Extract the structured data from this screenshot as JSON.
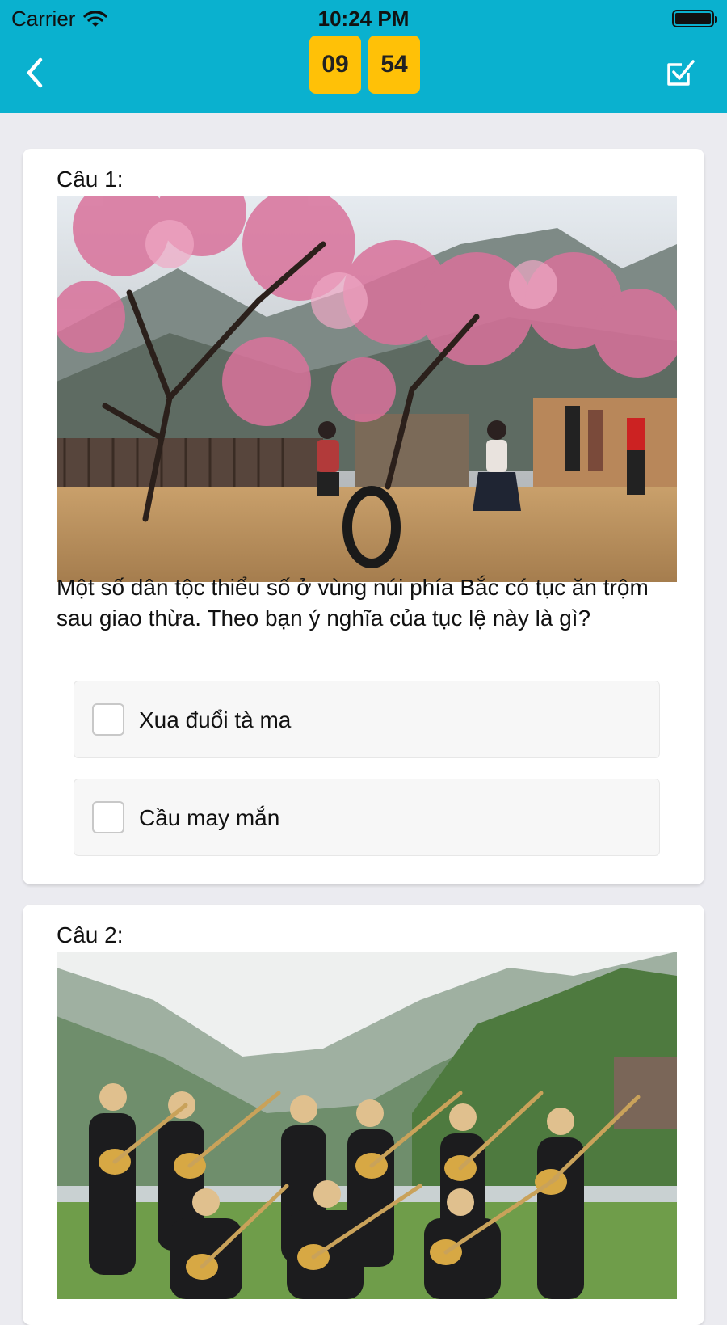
{
  "status_bar": {
    "carrier": "Carrier",
    "time": "10:24 PM",
    "battery_level": 1.0
  },
  "header": {
    "background": "#0AB1CF",
    "back_icon": "chevron-left-icon",
    "timer_minutes": "09",
    "timer_seconds": "54",
    "timer_color": "#FFC107",
    "submit_icon": "checkbox-edit-icon"
  },
  "questions": [
    {
      "label": "Câu 1:",
      "image": "photo-children-playing-under-peach-blossom-tree",
      "text": "Một số dân tộc thiểu số ở vùng núi phía Bắc có tục ăn trộm sau giao thừa. Theo bạn ý nghĩa của tục lệ này là gì?",
      "options": [
        {
          "label": "Xua đuổi tà ma",
          "checked": false
        },
        {
          "label": "Cầu may mắn",
          "checked": false
        }
      ]
    },
    {
      "label": "Câu 2:",
      "image": "photo-ethnic-musicians-with-lutes-by-lake"
    }
  ]
}
